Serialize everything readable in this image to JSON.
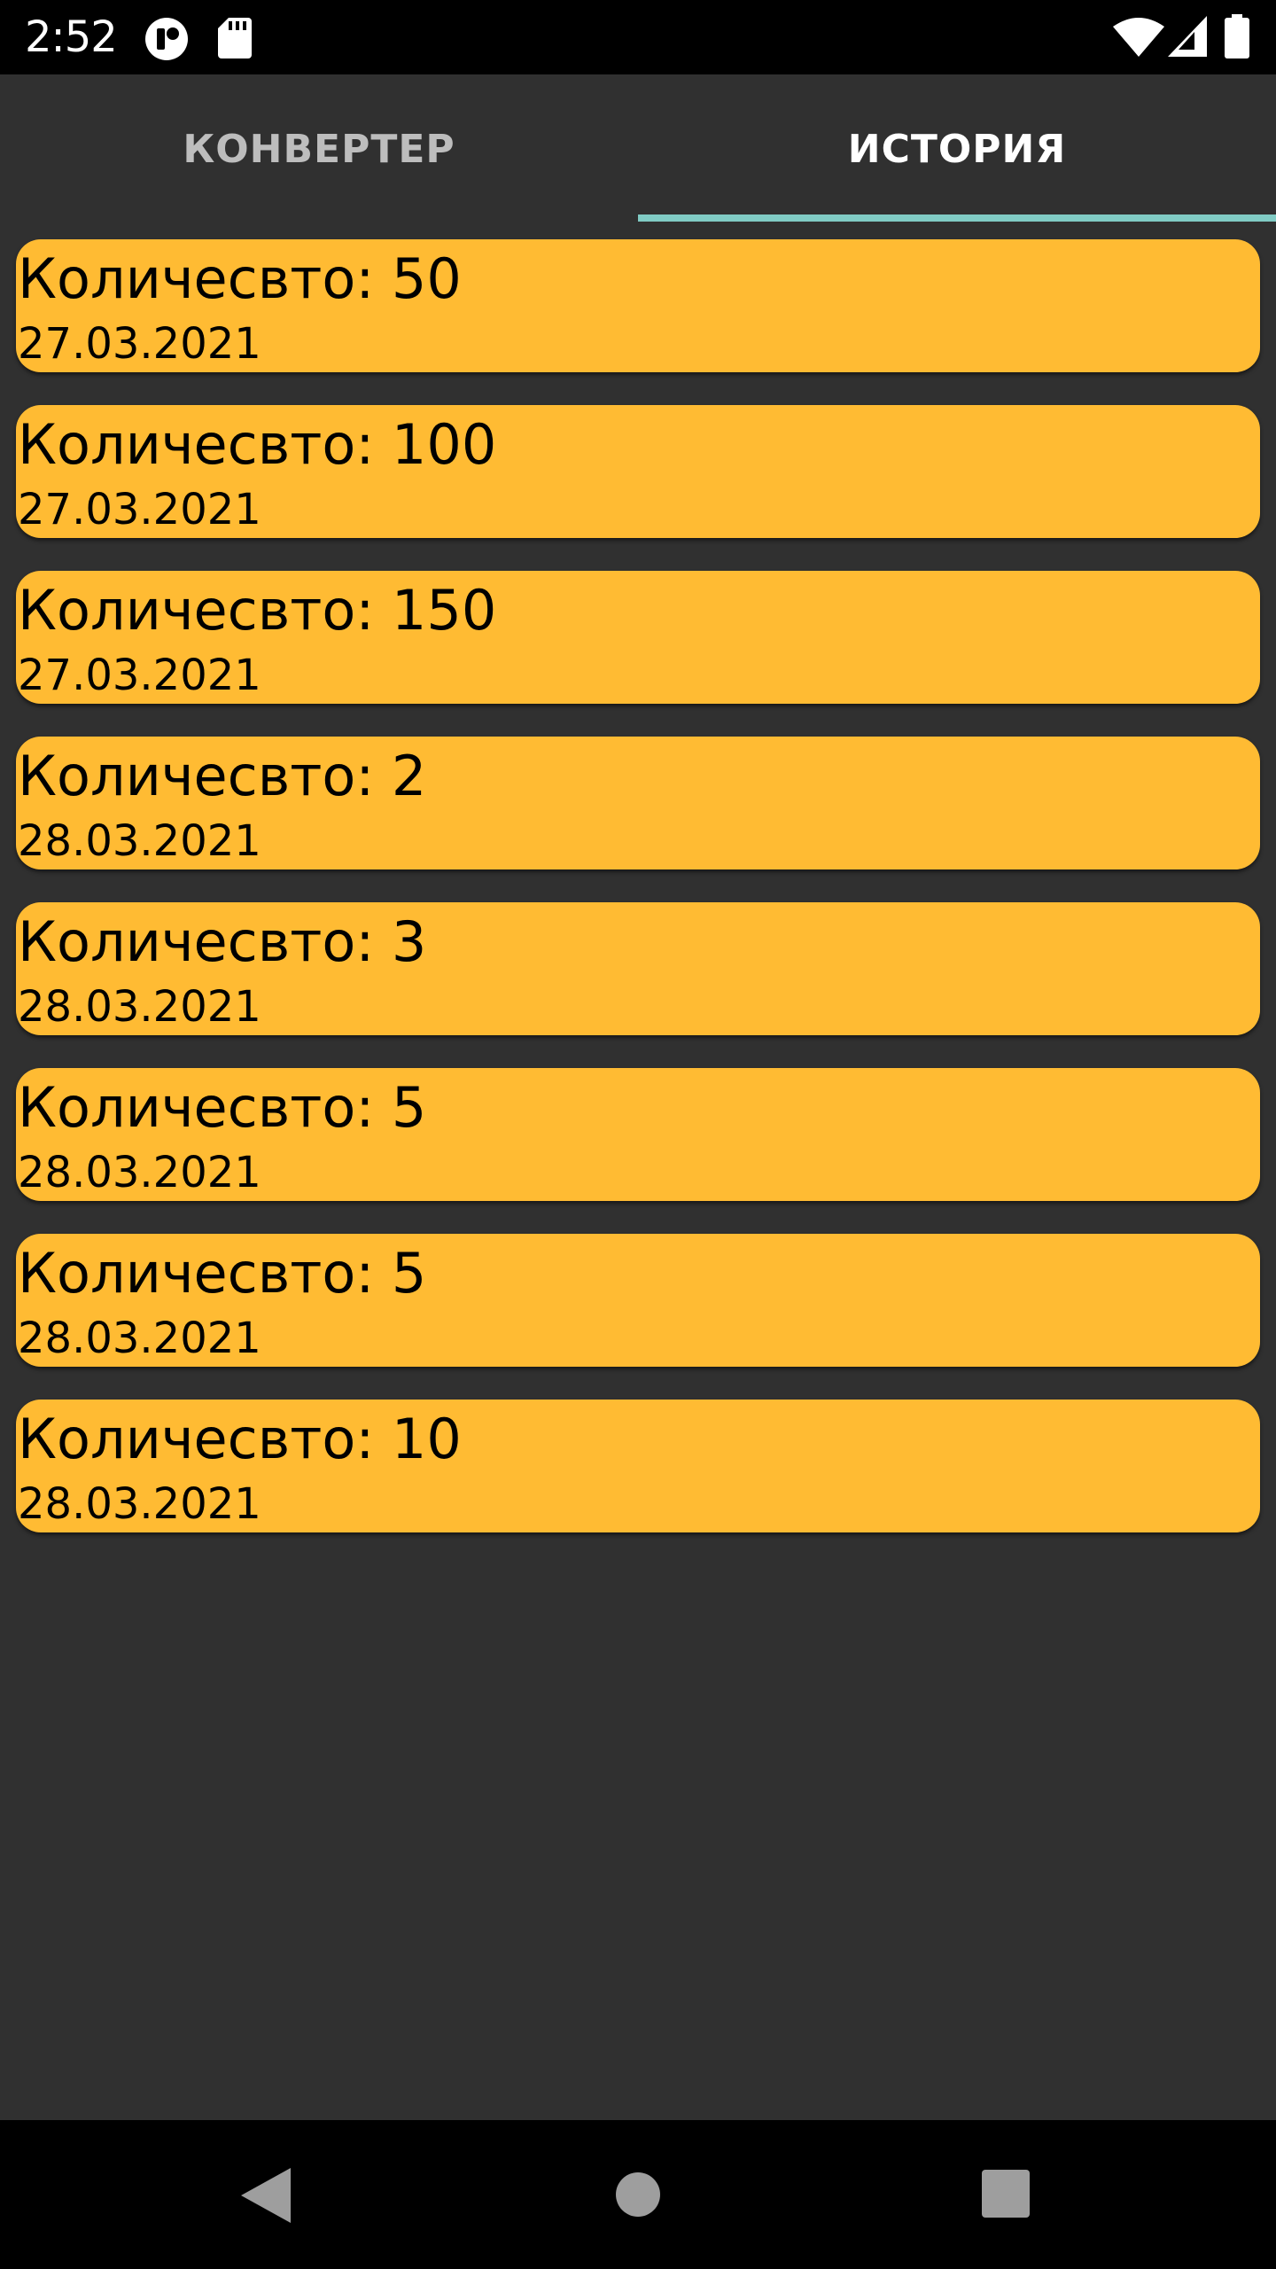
{
  "status_bar": {
    "time": "2:52",
    "icons": [
      "app-notification-icon",
      "sd-card-icon",
      "wifi-icon",
      "signal-icon",
      "battery-icon"
    ]
  },
  "tabs": [
    {
      "label": "КОНВЕРТЕР",
      "selected": false
    },
    {
      "label": "ИСТОРИЯ",
      "selected": true
    }
  ],
  "colors": {
    "background": "#303030",
    "card": "#ffbb33",
    "indicator": "#80cbc4"
  },
  "history": [
    {
      "amount": "Количесвто: 50",
      "date": "27.03.2021"
    },
    {
      "amount": "Количесвто: 100",
      "date": "27.03.2021"
    },
    {
      "amount": "Количесвто: 150",
      "date": "27.03.2021"
    },
    {
      "amount": "Количесвто: 2",
      "date": "28.03.2021"
    },
    {
      "amount": "Количесвто: 3",
      "date": "28.03.2021"
    },
    {
      "amount": "Количесвто: 5",
      "date": "28.03.2021"
    },
    {
      "amount": "Количесвто: 5",
      "date": "28.03.2021"
    },
    {
      "amount": "Количесвто: 10",
      "date": "28.03.2021"
    }
  ],
  "nav_bar": {
    "buttons": [
      "back-icon",
      "home-icon",
      "recents-icon"
    ]
  }
}
